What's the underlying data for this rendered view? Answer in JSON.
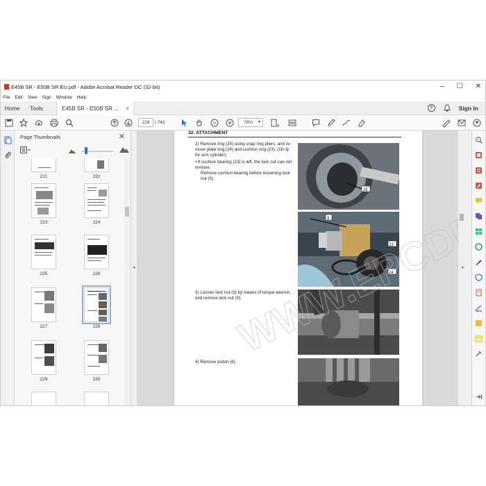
{
  "window": {
    "title": "E45B SR - E50B SR EU.pdf - Adobe Acrobat Reader DC (32-bit)",
    "minimize": "–",
    "maximize": "☐",
    "close": "✕"
  },
  "menu": [
    "File",
    "Edit",
    "View",
    "Sign",
    "Window",
    "Help"
  ],
  "tabs": {
    "home": "Home",
    "tools": "Tools",
    "doc": "E45B SR - E50B SR ...",
    "close": "×"
  },
  "topright": {
    "help": "?",
    "bell": "🔔",
    "signin": "Sign In"
  },
  "toolbar": {
    "page": "228",
    "page_count": "/  742",
    "zoom": "78%"
  },
  "thumbnails": {
    "title": "Page Thumbnails",
    "close": "✕",
    "pages": [
      "221",
      "222",
      "223",
      "224",
      "225",
      "226",
      "227",
      "228",
      "229",
      "230"
    ],
    "selected": "228"
  },
  "document": {
    "section": "32. ATTACHMENT",
    "step2": "2) Remove ring (25) using snap ring pliers, and re-move plate ring (24) and cushion ring (23). (On-ly for arm cylinder).",
    "bullet": "•  If cushion bearing (23) is left, the lock nut can-not remove.",
    "bullet_cont": "Remove cushion bearing before loosening lock nut (9).",
    "step3": "3) Loosen lock nut (9) by means of torque wrench, and remove lock nut (9).",
    "step4": "4) Remove piston (6).",
    "callouts": {
      "c23": "23",
      "c9": "9",
      "c24": "24",
      "c25": "25"
    }
  },
  "watermark": "WWW.EPCDEPOT.COM",
  "colors": {
    "accent": "#2d6ee6",
    "pdf_red": "#c0392b",
    "tool_green": "#7cb342",
    "tool_purple": "#8e44ad"
  }
}
